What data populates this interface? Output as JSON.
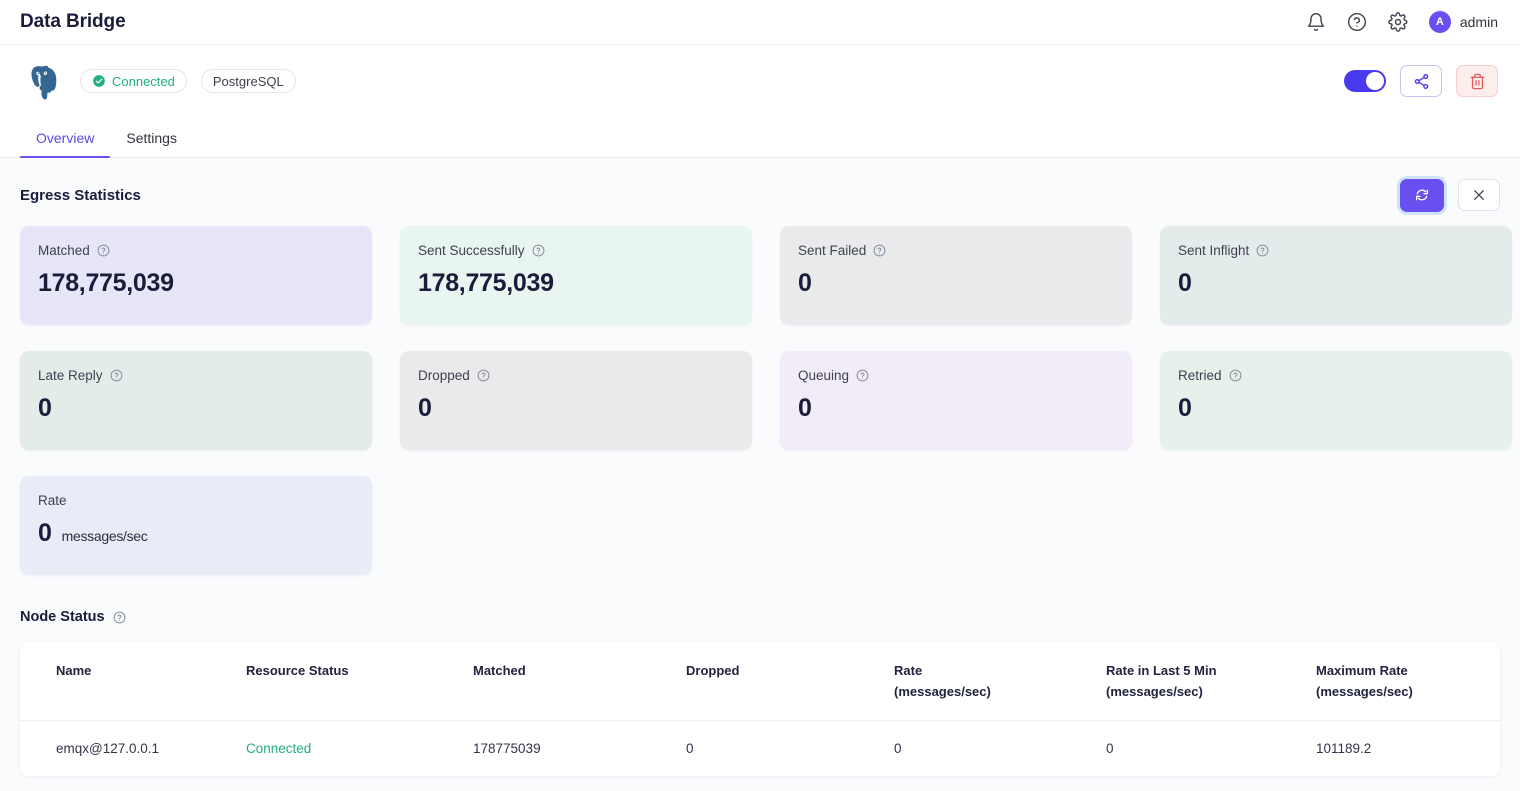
{
  "header": {
    "title": "Data Bridge",
    "icons": [
      "bell-icon",
      "help-icon",
      "gear-icon"
    ],
    "user": {
      "initial": "A",
      "name": "admin"
    }
  },
  "resource": {
    "logo": "postgresql-elephant-logo",
    "status_badge": "Connected",
    "type_badge": "PostgreSQL",
    "toggle_on": true,
    "share_label": "share-icon",
    "delete_label": "trash-icon"
  },
  "tabs": [
    {
      "label": "Overview",
      "active": true
    },
    {
      "label": "Settings",
      "active": false
    }
  ],
  "statistics": {
    "title": "Egress Statistics",
    "refresh_label": "refresh-icon",
    "close_label": "close-icon",
    "cards": [
      {
        "label": "Matched",
        "value": "178,775,039",
        "unit": "",
        "help": true,
        "bg": "#e6e6f8"
      },
      {
        "label": "Sent Successfully",
        "value": "178,775,039",
        "unit": "",
        "help": true,
        "bg": "#e9f5f1"
      },
      {
        "label": "Sent Failed",
        "value": "0",
        "unit": "",
        "help": true,
        "bg": "#e9eaec"
      },
      {
        "label": "Sent Inflight",
        "value": "0",
        "unit": "",
        "help": true,
        "bg": "#e4eceb"
      },
      {
        "label": "Late Reply",
        "value": "0",
        "unit": "",
        "help": true,
        "bg": "#e4ecea"
      },
      {
        "label": "Dropped",
        "value": "0",
        "unit": "",
        "help": true,
        "bg": "#eaeaec"
      },
      {
        "label": "Queuing",
        "value": "0",
        "unit": "",
        "help": true,
        "bg": "#f1ecf8"
      },
      {
        "label": "Retried",
        "value": "0",
        "unit": "",
        "help": true,
        "bg": "#e6f1ec"
      },
      {
        "label": "Rate",
        "value": "0",
        "unit": "messages/sec",
        "help": false,
        "bg": "#e7ecf7"
      }
    ]
  },
  "node_status": {
    "title": "Node Status",
    "columns": [
      "Name",
      "Resource Status",
      "Matched",
      "Dropped",
      "Rate\n(messages/sec)",
      "Rate in Last 5 Min\n(messages/sec)",
      "Maximum Rate\n(messages/sec)"
    ],
    "rows": [
      {
        "name": "emqx@127.0.0.1",
        "resource_status": "Connected",
        "matched": "178775039",
        "dropped": "0",
        "rate": "0",
        "rate_last_5min": "0",
        "max_rate": "101189.2"
      }
    ]
  },
  "colors": {
    "accent": "#6a4ff0",
    "success": "#22b07d",
    "danger": "#e35b5b",
    "text": "#1b1c3a",
    "page_bg": "#fafbfd"
  }
}
